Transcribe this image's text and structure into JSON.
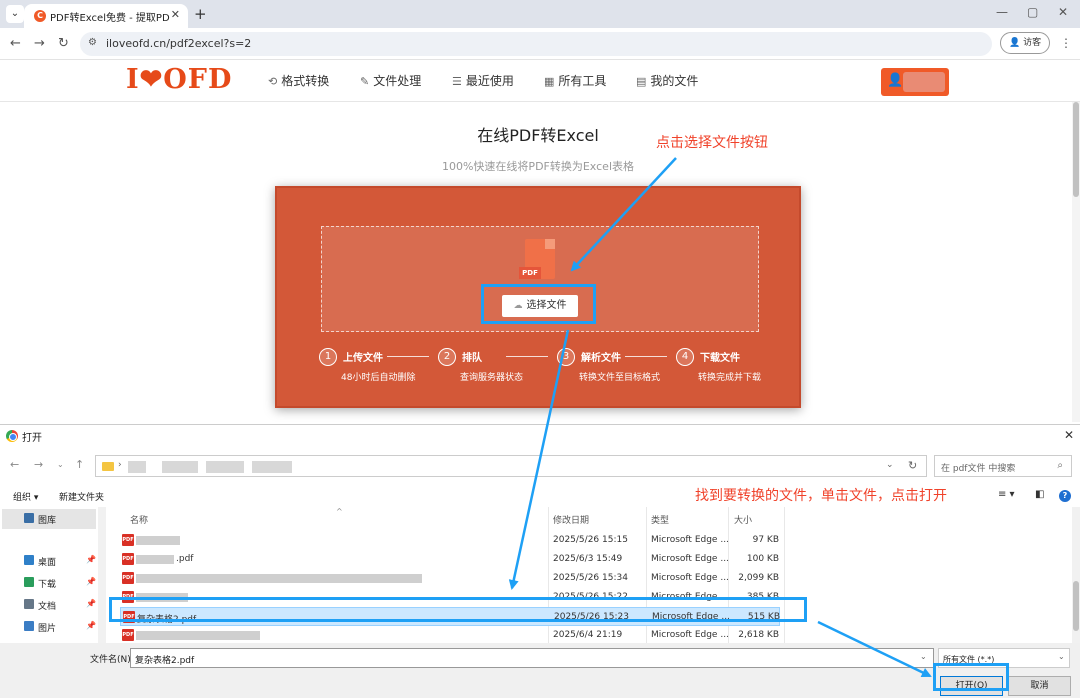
{
  "browser": {
    "tab_title": "PDF转Excel免费 - 提取PDF表格",
    "url": "iloveofd.cn/pdf2excel?s=2",
    "guest_label": "访客"
  },
  "site": {
    "logo": "I❤OFD",
    "nav": [
      {
        "icon": "format-convert-icon",
        "label": "格式转换"
      },
      {
        "icon": "file-process-icon",
        "label": "文件处理"
      },
      {
        "icon": "recent-icon",
        "label": "最近使用"
      },
      {
        "icon": "all-tools-icon",
        "label": "所有工具"
      },
      {
        "icon": "my-files-icon",
        "label": "我的文件"
      }
    ]
  },
  "main": {
    "title": "在线PDF转Excel",
    "subtitle": "100%快速在线将PDF转换为Excel表格",
    "pdf_tag": "PDF",
    "select_button": "选择文件",
    "steps": [
      {
        "num": "1",
        "title": "上传文件",
        "desc": "48小时后自动删除"
      },
      {
        "num": "2",
        "title": "排队",
        "desc": "查询服务器状态"
      },
      {
        "num": "3",
        "title": "解析文件",
        "desc": "转换文件至目标格式"
      },
      {
        "num": "4",
        "title": "下载文件",
        "desc": "转换完成并下载"
      }
    ]
  },
  "annotations": {
    "select_hint": "点击选择文件按钮",
    "open_hint": "找到要转换的文件，单击文件，点击打开"
  },
  "dialog": {
    "title": "打开",
    "search_placeholder": "在 pdf文件 中搜索",
    "toolbar": {
      "organize": "组织 ▾",
      "new_folder": "新建文件夹"
    },
    "sidebar": [
      {
        "icon": "gallery-icon",
        "label": "图库",
        "color": "#3a6ea5"
      },
      {
        "icon": "desktop-icon",
        "label": "桌面",
        "color": "#2f80c8"
      },
      {
        "icon": "download-icon",
        "label": "下载",
        "color": "#2a9d5c"
      },
      {
        "icon": "documents-icon",
        "label": "文档",
        "color": "#667788"
      },
      {
        "icon": "pictures-icon",
        "label": "图片",
        "color": "#3b7dc4"
      }
    ],
    "columns": {
      "name": "名称",
      "date": "修改日期",
      "type": "类型",
      "size": "大小"
    },
    "rows": [
      {
        "name": "",
        "date": "2025/5/26 15:15",
        "type": "Microsoft Edge ...",
        "size": "97 KB"
      },
      {
        "name": ".pdf",
        "date": "2025/6/3 15:49",
        "type": "Microsoft Edge ...",
        "size": "100 KB"
      },
      {
        "name": "",
        "date": "2025/5/26 15:34",
        "type": "Microsoft Edge ...",
        "size": "2,099 KB"
      },
      {
        "name": "",
        "date": "2025/5/26 15:22",
        "type": "Microsoft Edge ...",
        "size": "385 KB"
      },
      {
        "name": "复杂表格2.pdf",
        "date": "2025/5/26 15:23",
        "type": "Microsoft Edge ...",
        "size": "515 KB"
      },
      {
        "name": "",
        "date": "2025/6/4 21:19",
        "type": "Microsoft Edge ...",
        "size": "2,618 KB"
      }
    ],
    "filename_label": "文件名(N):",
    "filename_value": "复杂表格2.pdf",
    "filetype_value": "所有文件 (*.*)",
    "open_button": "打开(O)",
    "cancel_button": "取消"
  },
  "colors": {
    "brand": "#f05a28",
    "card": "#d35838",
    "highlight": "#1ea0f5",
    "annotation": "#f0422a"
  }
}
